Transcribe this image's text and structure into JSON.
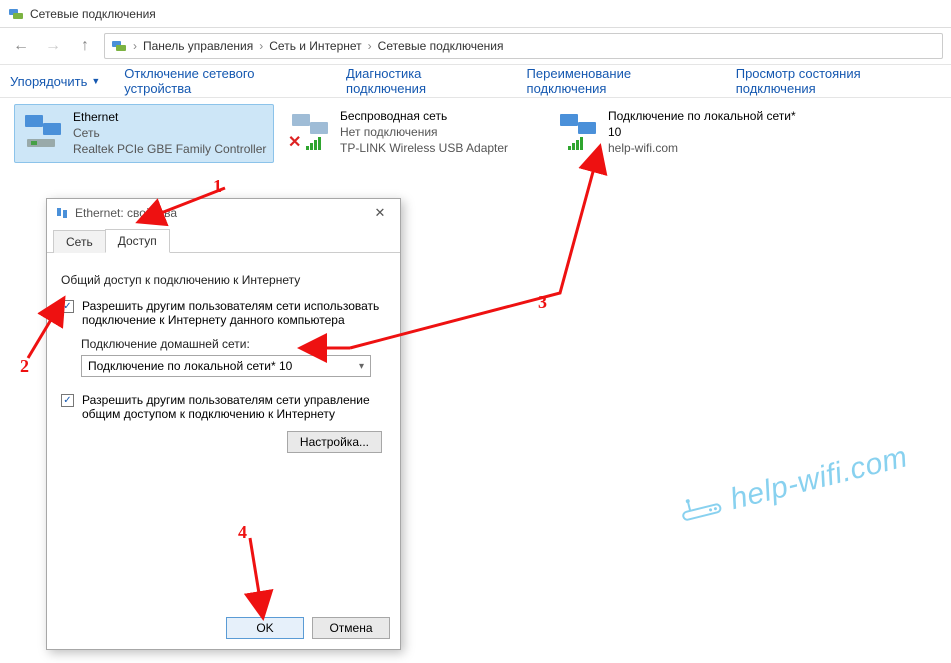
{
  "window": {
    "title": "Сетевые подключения"
  },
  "breadcrumbs": {
    "root": "Панель управления",
    "mid": "Сеть и Интернет",
    "leaf": "Сетевые подключения"
  },
  "toolbar": {
    "organize": "Упорядочить",
    "disable": "Отключение сетевого устройства",
    "diagnose": "Диагностика подключения",
    "rename": "Переименование подключения",
    "status": "Просмотр состояния подключения"
  },
  "connections": [
    {
      "title": "Ethernet",
      "line2": "Сеть",
      "line3": "Realtek PCIe GBE Family Controller"
    },
    {
      "title": "Беспроводная сеть",
      "line2": "Нет подключения",
      "line3": "TP-LINK Wireless USB Adapter"
    },
    {
      "title": "Подключение по локальной сети* 10",
      "line2": "help-wifi.com",
      "line3": ""
    }
  ],
  "dialog": {
    "title": "Ethernet: свойства",
    "tabs": {
      "net": "Сеть",
      "access": "Доступ"
    },
    "group": "Общий доступ к подключению к Интернету",
    "chk1": "Разрешить другим пользователям сети использовать подключение к Интернету данного компьютера",
    "home_label": "Подключение домашней сети:",
    "home_value": "Подключение по локальной сети* 10",
    "chk2": "Разрешить другим пользователям сети управление общим доступом к подключению к Интернету",
    "settings_btn": "Настройка...",
    "ok": "OK",
    "cancel": "Отмена"
  },
  "steps": {
    "s1": "1",
    "s2": "2",
    "s3": "3",
    "s4": "4"
  },
  "watermark": {
    "text": "help-wifi.com"
  }
}
